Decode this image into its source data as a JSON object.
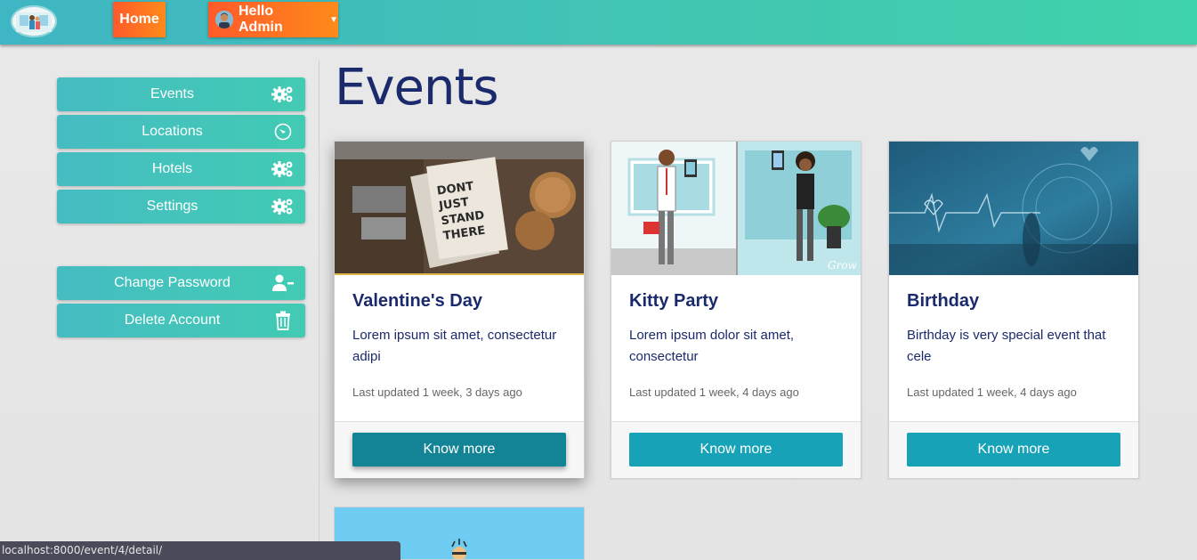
{
  "navbar": {
    "logo_icon": "app-logo-icon",
    "home_label": "Home",
    "user_label": "Hello Admin",
    "user_avatar_icon": "user-avatar-icon",
    "dropdown_icon": "caret-down-icon",
    "accent_orange": "#ff6a22",
    "gradient_start": "#3fb6c3",
    "gradient_end": "#3fd3ab"
  },
  "sidebar": {
    "items": [
      {
        "label": "Events",
        "icon": "gears-icon"
      },
      {
        "label": "Locations",
        "icon": "compass-icon"
      },
      {
        "label": "Hotels",
        "icon": "gears-icon"
      },
      {
        "label": "Settings",
        "icon": "gears-icon"
      }
    ],
    "account": [
      {
        "label": "Change Password",
        "icon": "user-minus-icon"
      },
      {
        "label": "Delete Account",
        "icon": "trash-icon"
      }
    ]
  },
  "main": {
    "title": "Events",
    "cards": [
      {
        "title": "Valentine's Day",
        "description": "Lorem ipsum sit amet, consectetur adipi",
        "updated": "Last updated 1 week, 3 days ago",
        "button": "Know more",
        "image_text": "DON'T JUST STAND THERE"
      },
      {
        "title": "Kitty Party",
        "description": "Lorem ipsum dolor sit amet, consectetur",
        "updated": "Last updated 1 week, 4 days ago",
        "button": "Know more",
        "image_text": "Grow"
      },
      {
        "title": "Birthday",
        "description": "Birthday is very special event that cele",
        "updated": "Last updated 1 week, 4 days ago",
        "button": "Know more"
      }
    ],
    "button_color": "#17a2b8",
    "title_color": "#1a2a6c"
  },
  "statusbar": {
    "url": "localhost:8000/event/4/detail/"
  }
}
